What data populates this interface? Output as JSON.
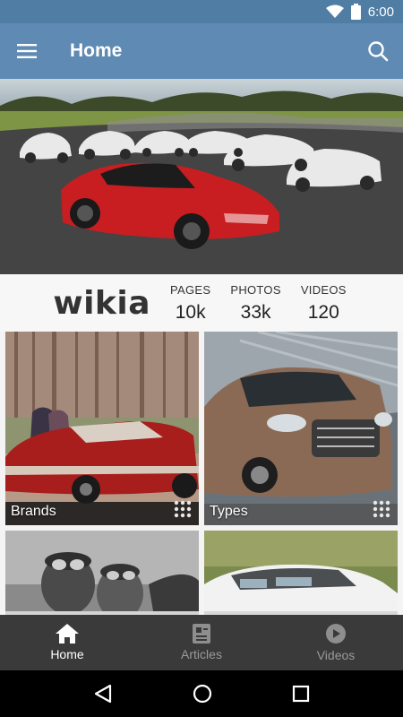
{
  "status_bar": {
    "time": "6:00"
  },
  "app_bar": {
    "title": "Home"
  },
  "stats": {
    "logo_text": "wikia",
    "items": [
      {
        "label": "PAGES",
        "value": "10k"
      },
      {
        "label": "PHOTOS",
        "value": "33k"
      },
      {
        "label": "VIDEOS",
        "value": "120"
      }
    ]
  },
  "tiles": [
    {
      "label": "Brands"
    },
    {
      "label": "Types"
    }
  ],
  "bottom_nav": {
    "items": [
      {
        "label": "Home",
        "icon": "home-icon"
      },
      {
        "label": "Articles",
        "icon": "articles-icon"
      },
      {
        "label": "Videos",
        "icon": "videos-icon"
      }
    ]
  },
  "colors": {
    "status_bar": "#4f7da3",
    "app_bar": "#5f8ab3",
    "bottom_nav": "#3a3a3a"
  }
}
